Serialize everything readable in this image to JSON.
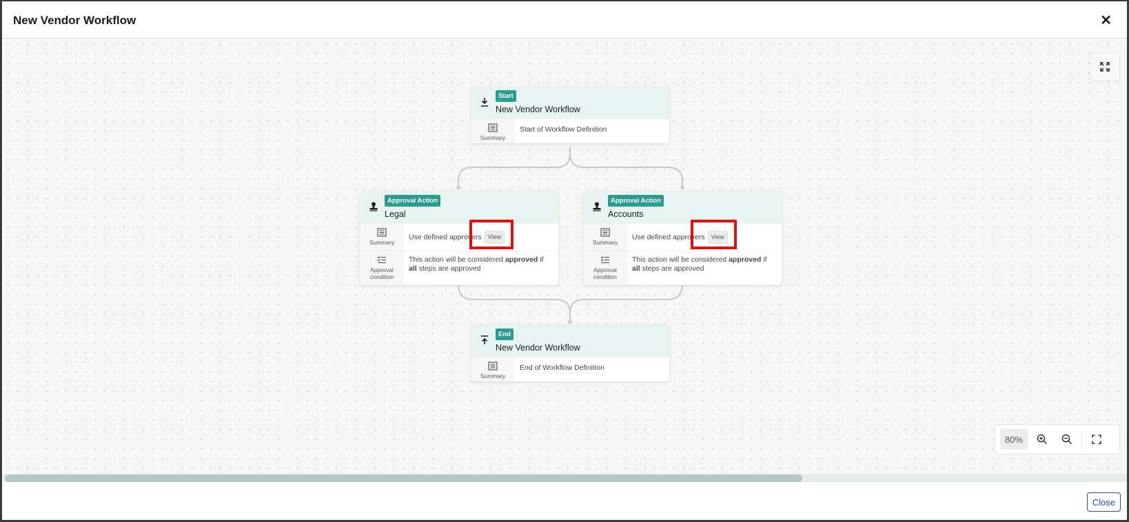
{
  "modal": {
    "title": "New Vendor Workflow",
    "close_label": "Close"
  },
  "nodes": {
    "start": {
      "badge": "Start",
      "title": "New Vendor Workflow",
      "summary_label": "Summary",
      "summary_text": "Start of Workflow Definition"
    },
    "legal": {
      "badge": "Approval Action",
      "title": "Legal",
      "summary_label": "Summary",
      "summary_text": "Use defined approvers",
      "view_label": "View",
      "condition_label": "Approval condition",
      "condition_pre": "This action will be considered ",
      "condition_bold1": "approved",
      "condition_mid": " if ",
      "condition_bold2": "all",
      "condition_post": " steps are approved"
    },
    "accounts": {
      "badge": "Approval Action",
      "title": "Accounts",
      "summary_label": "Summary",
      "summary_text": "Use defined approvers",
      "view_label": "View",
      "condition_label": "Approval condition",
      "condition_pre": "This action will be considered ",
      "condition_bold1": "approved",
      "condition_mid": " if ",
      "condition_bold2": "all",
      "condition_post": " steps are approved"
    },
    "end": {
      "badge": "End",
      "title": "New Vendor Workflow",
      "summary_label": "Summary",
      "summary_text": "End of Workflow Definition"
    }
  },
  "zoom": {
    "level": "80%"
  },
  "icons": {
    "close": "close-icon",
    "fit": "fit-view-icon",
    "start": "download-icon",
    "approval": "stamp-icon",
    "summary": "summary-list-icon",
    "condition": "checklist-icon",
    "end": "upload-icon",
    "zoom_in": "zoom-in-icon",
    "zoom_out": "zoom-out-icon",
    "fullscreen": "fullscreen-icon"
  },
  "colors": {
    "badge": "#2c9c8f",
    "node_header": "#e8f4f2",
    "highlight": "#e01010",
    "primary": "#2b4aa3"
  }
}
